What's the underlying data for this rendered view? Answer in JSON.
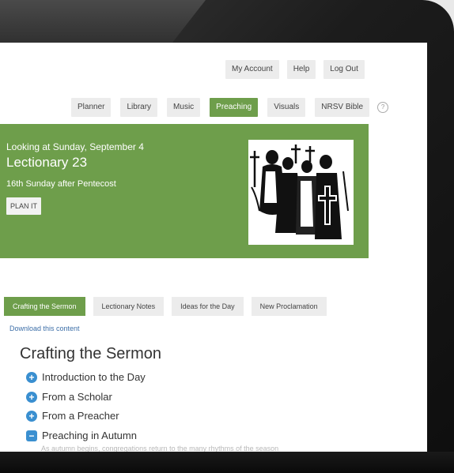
{
  "top_nav": {
    "account": "My Account",
    "help": "Help",
    "logout": "Log Out"
  },
  "main_nav": {
    "items": [
      "Planner",
      "Library",
      "Music",
      "Preaching",
      "Visuals",
      "NRSV Bible"
    ],
    "active": "Preaching",
    "help_glyph": "?"
  },
  "hero": {
    "kicker": "Looking at Sunday, September 4",
    "title": "Lectionary 23",
    "subtitle": "16th Sunday after Pentecost",
    "plan_button": "PLAN IT",
    "background": "#6e9e4b"
  },
  "tabs": [
    "Crafting the Sermon",
    "Lectionary Notes",
    "Ideas for the Day",
    "New Proclamation"
  ],
  "download_link": "Download this content",
  "section_title": "Crafting the Sermon",
  "accordion": [
    {
      "label": "Introduction to the Day",
      "icon": "plus-circle-icon"
    },
    {
      "label": "From a Scholar",
      "icon": "plus-circle-icon"
    },
    {
      "label": "From a Preacher",
      "icon": "plus-circle-icon"
    },
    {
      "label": "Preaching in Autumn",
      "icon": "minus-square-icon"
    }
  ],
  "cut_text": "As autumn begins, congregations return to the many rhythms of the season",
  "colors": {
    "accent": "#6e9e4b",
    "link": "#3d6fa8",
    "icon": "#3a8fd0"
  }
}
